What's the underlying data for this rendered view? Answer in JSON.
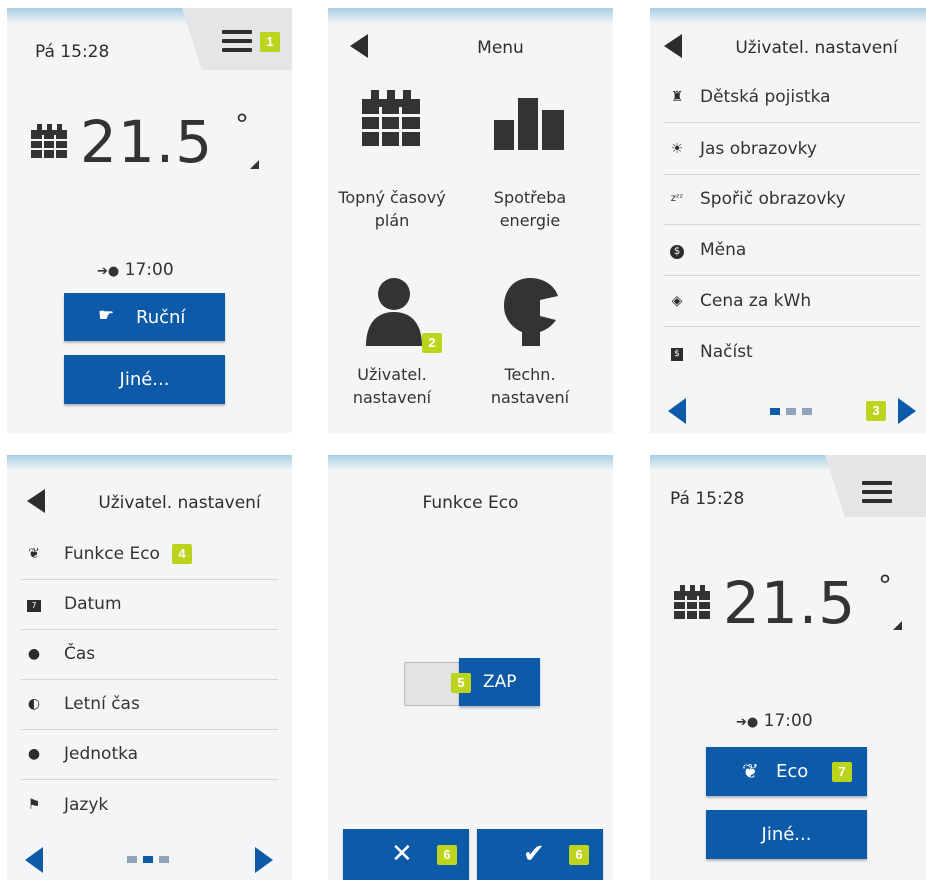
{
  "colors": {
    "accent": "#0c5aa8",
    "badge": "#bcd41c",
    "text": "#2d2d2d",
    "panel": "#f4f5f6"
  },
  "screen1": {
    "time": "Pá 15:28",
    "badge": "1",
    "temperature": "21.5",
    "degree": "°",
    "next_time": "17:00",
    "btn_manual": "Ruční",
    "btn_other": "Jiné..."
  },
  "screen2": {
    "title": "Menu",
    "badge": "2",
    "tiles": [
      {
        "label_line1": "Topný časový",
        "label_line2": "plán",
        "icon": "calendar-icon"
      },
      {
        "label_line1": "Spotřeba",
        "label_line2": "energie",
        "icon": "bar-chart-icon"
      },
      {
        "label_line1": "Uživatel.",
        "label_line2": "nastavení",
        "icon": "user-icon"
      },
      {
        "label_line1": "Techn.",
        "label_line2": "nastavení",
        "icon": "wrench-icon"
      }
    ]
  },
  "screen3": {
    "title": "Uživatel. nastavení",
    "badge": "3",
    "items": [
      {
        "label": "Dětská pojistka",
        "icon": "child-lock-icon"
      },
      {
        "label": "Jas obrazovky",
        "icon": "brightness-icon"
      },
      {
        "label": "Spořič obrazovky",
        "icon": "screensaver-icon"
      },
      {
        "label": "Měna",
        "icon": "currency-icon"
      },
      {
        "label": "Cena za kWh",
        "icon": "price-tag-icon"
      },
      {
        "label": "Načíst",
        "icon": "load-icon"
      }
    ]
  },
  "screen4": {
    "title": "Uživatel. nastavení",
    "badge": "4",
    "items": [
      {
        "label": "Funkce Eco",
        "icon": "leaf-icon"
      },
      {
        "label": "Datum",
        "icon": "date-icon"
      },
      {
        "label": "Čas",
        "icon": "clock-icon"
      },
      {
        "label": "Letní čas",
        "icon": "daylight-saving-icon"
      },
      {
        "label": "Jednotka",
        "icon": "unit-icon"
      },
      {
        "label": "Jazyk",
        "icon": "flag-icon"
      }
    ]
  },
  "screen5": {
    "title": "Funkce Eco",
    "toggle_label": "ZAP",
    "toggle_badge": "5",
    "cancel_badge": "6",
    "confirm_badge": "6"
  },
  "screen6": {
    "time": "Pá 15:28",
    "temperature": "21.5",
    "degree": "°",
    "next_time": "17:00",
    "btn_eco": "Eco",
    "badge": "7",
    "btn_other": "Jiné..."
  }
}
